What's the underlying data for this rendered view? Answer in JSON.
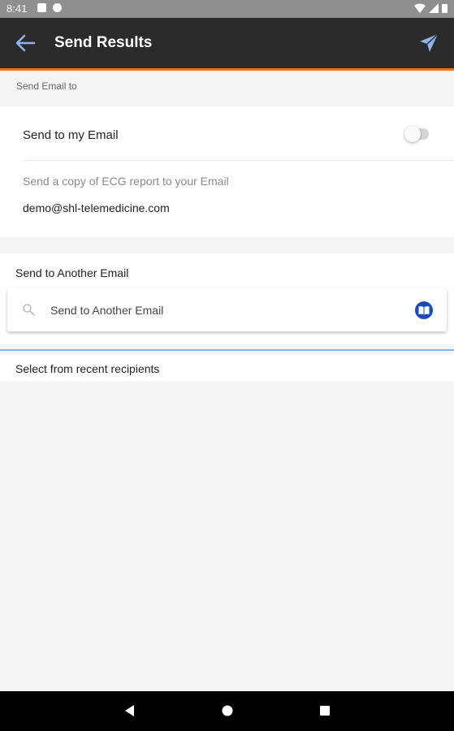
{
  "status_bar": {
    "time": "8:41"
  },
  "app_bar": {
    "title": "Send Results",
    "back_icon": "arrow-back-icon",
    "send_icon": "send-icon"
  },
  "section_label": "Send Email to",
  "my_email": {
    "title": "Send to my Email",
    "toggle_on": false,
    "description": "Send a copy of ECG report to your Email",
    "email": "demo@shl-telemedicine.com"
  },
  "another_email": {
    "label": "Send to Another Email",
    "placeholder": "Send to Another Email",
    "contacts_icon": "address-book-icon"
  },
  "recent": {
    "label": "Select from recent recipients"
  },
  "colors": {
    "appbar": "#2b2b2b",
    "accent": "#e8742a",
    "icon_blue": "#1a49b8"
  }
}
